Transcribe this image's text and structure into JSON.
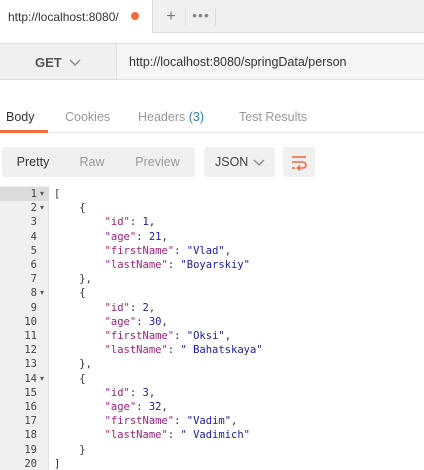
{
  "tabs": {
    "request_tab_label": "http://localhost:8080/",
    "new_tab_label": "+",
    "more_label": "•••"
  },
  "request": {
    "method": "GET",
    "url": "http://localhost:8080/springData/person"
  },
  "response_tabs": {
    "body": "Body",
    "cookies": "Cookies",
    "headers": "Headers",
    "headers_count": "(3)",
    "test_results": "Test Results",
    "active": "Body"
  },
  "view": {
    "pretty": "Pretty",
    "raw": "Raw",
    "preview": "Preview",
    "active": "Pretty",
    "language": "JSON"
  },
  "colors": {
    "accent": "#f26b3a",
    "key": "#a1207e",
    "value": "#1a1aa6",
    "badge": "#2a80b9"
  },
  "code_lines": [
    {
      "n": "1",
      "fold": "▾",
      "indent": "",
      "open": "["
    },
    {
      "n": "2",
      "fold": "▾",
      "indent": "    ",
      "open": "{"
    },
    {
      "n": "3",
      "fold": "",
      "indent": "        ",
      "key": "\"id\"",
      "val": "1",
      "val_type": "num",
      "comma": ","
    },
    {
      "n": "4",
      "fold": "",
      "indent": "        ",
      "key": "\"age\"",
      "val": "21",
      "val_type": "num",
      "comma": ","
    },
    {
      "n": "5",
      "fold": "",
      "indent": "        ",
      "key": "\"firstName\"",
      "val": "\"Vlad\"",
      "val_type": "str",
      "comma": ","
    },
    {
      "n": "6",
      "fold": "",
      "indent": "        ",
      "key": "\"lastName\"",
      "val": "\"Boyarskiy\"",
      "val_type": "str",
      "comma": ""
    },
    {
      "n": "7",
      "fold": "",
      "indent": "    ",
      "open": "},"
    },
    {
      "n": "8",
      "fold": "▾",
      "indent": "    ",
      "open": "{"
    },
    {
      "n": "9",
      "fold": "",
      "indent": "        ",
      "key": "\"id\"",
      "val": "2",
      "val_type": "num",
      "comma": ","
    },
    {
      "n": "10",
      "fold": "",
      "indent": "        ",
      "key": "\"age\"",
      "val": "30",
      "val_type": "num",
      "comma": ","
    },
    {
      "n": "11",
      "fold": "",
      "indent": "        ",
      "key": "\"firstName\"",
      "val": "\"Oksi\"",
      "val_type": "str",
      "comma": ","
    },
    {
      "n": "12",
      "fold": "",
      "indent": "        ",
      "key": "\"lastName\"",
      "val": "\" Bahatskaya\"",
      "val_type": "str",
      "comma": ""
    },
    {
      "n": "13",
      "fold": "",
      "indent": "    ",
      "open": "},"
    },
    {
      "n": "14",
      "fold": "▾",
      "indent": "    ",
      "open": "{"
    },
    {
      "n": "15",
      "fold": "",
      "indent": "        ",
      "key": "\"id\"",
      "val": "3",
      "val_type": "num",
      "comma": ","
    },
    {
      "n": "16",
      "fold": "",
      "indent": "        ",
      "key": "\"age\"",
      "val": "32",
      "val_type": "num",
      "comma": ","
    },
    {
      "n": "17",
      "fold": "",
      "indent": "        ",
      "key": "\"firstName\"",
      "val": "\"Vadim\"",
      "val_type": "str",
      "comma": ","
    },
    {
      "n": "18",
      "fold": "",
      "indent": "        ",
      "key": "\"lastName\"",
      "val": "\" Vadimich\"",
      "val_type": "str",
      "comma": ""
    },
    {
      "n": "19",
      "fold": "",
      "indent": "    ",
      "open": "}"
    },
    {
      "n": "20",
      "fold": "",
      "indent": "",
      "open": "]"
    }
  ],
  "highlighted_line": "1"
}
